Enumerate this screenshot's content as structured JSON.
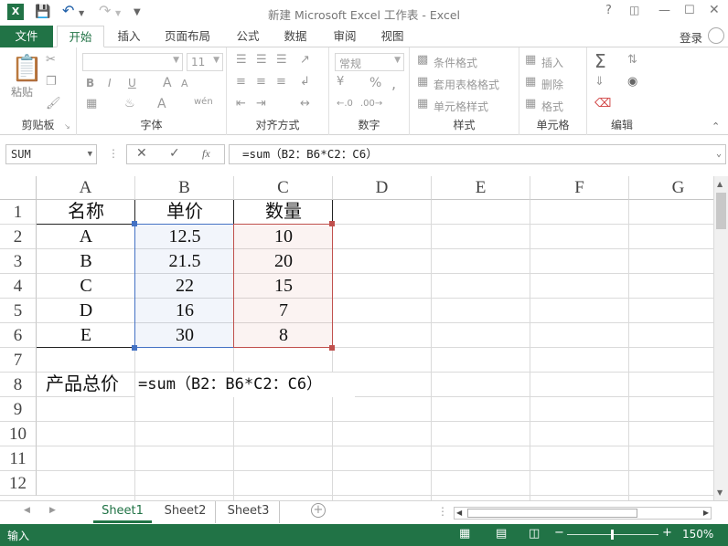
{
  "window": {
    "title": "新建 Microsoft Excel 工作表 - Excel",
    "help": "?",
    "login": "登录"
  },
  "tabs": [
    {
      "label": "文件"
    },
    {
      "label": "开始"
    },
    {
      "label": "插入"
    },
    {
      "label": "页面布局"
    },
    {
      "label": "公式"
    },
    {
      "label": "数据"
    },
    {
      "label": "审阅"
    },
    {
      "label": "视图"
    }
  ],
  "ribbon": {
    "clipboard": {
      "label": "剪贴板",
      "paste": "粘贴"
    },
    "font": {
      "label": "字体",
      "size": "11",
      "bold": "B",
      "italic": "I",
      "underline": "U",
      "grow": "A",
      "shrink": "A",
      "phonetic": "wén"
    },
    "alignment": {
      "label": "对齐方式"
    },
    "number": {
      "label": "数字",
      "format": "常规",
      "percent": "%",
      "comma": ","
    },
    "styles": {
      "label": "样式",
      "conditional": "条件格式",
      "table": "套用表格格式",
      "cell": "单元格样式"
    },
    "cells": {
      "label": "单元格",
      "insert": "插入",
      "delete": "删除",
      "format": "格式"
    },
    "editing": {
      "label": "编辑"
    }
  },
  "formula_bar": {
    "name_box": "SUM",
    "fx": "fx",
    "formula": "=sum（B2：B6*C2：C6）"
  },
  "columns": [
    "A",
    "B",
    "C",
    "D",
    "E",
    "F",
    "G"
  ],
  "rows": [
    "1",
    "2",
    "3",
    "4",
    "5",
    "6",
    "7",
    "8",
    "9",
    "10",
    "11",
    "12"
  ],
  "cells": {
    "r1": [
      "名称",
      "单价",
      "数量"
    ],
    "r2": [
      "A",
      "12.5",
      "10"
    ],
    "r3": [
      "B",
      "21.5",
      "20"
    ],
    "r4": [
      "C",
      "22",
      "15"
    ],
    "r5": [
      "D",
      "16",
      "7"
    ],
    "r6": [
      "E",
      "30",
      "8"
    ],
    "r8": [
      "产品总价",
      "=sum（B2：B6*C2：C6）"
    ]
  },
  "sheets": [
    {
      "label": "Sheet1"
    },
    {
      "label": "Sheet2"
    },
    {
      "label": "Sheet3"
    }
  ],
  "status": {
    "mode": "输入",
    "zoom": "150%"
  },
  "colors": {
    "accent": "#217346",
    "range_b": "#4472c4",
    "range_c": "#c0504d"
  }
}
